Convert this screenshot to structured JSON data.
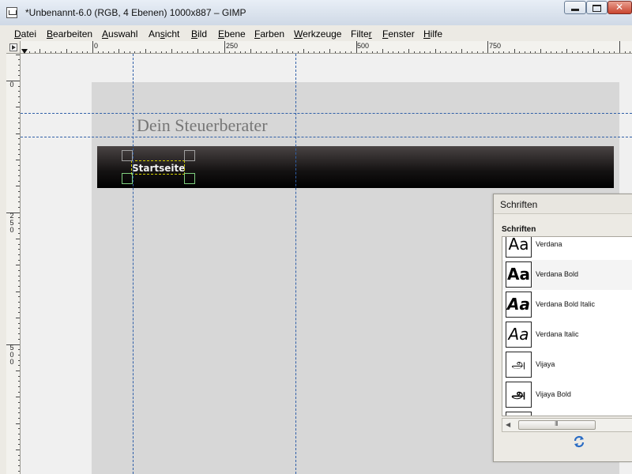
{
  "window": {
    "title": "*Unbenannt-6.0 (RGB, 4 Ebenen) 1000x887 – GIMP"
  },
  "menu": [
    {
      "pre": "",
      "u": "D",
      "post": "atei"
    },
    {
      "pre": "",
      "u": "B",
      "post": "earbeiten"
    },
    {
      "pre": "",
      "u": "A",
      "post": "uswahl"
    },
    {
      "pre": "An",
      "u": "s",
      "post": "icht"
    },
    {
      "pre": "",
      "u": "B",
      "post": "ild"
    },
    {
      "pre": "",
      "u": "E",
      "post": "bene"
    },
    {
      "pre": "",
      "u": "F",
      "post": "arben"
    },
    {
      "pre": "",
      "u": "W",
      "post": "erkzeuge"
    },
    {
      "pre": "Filte",
      "u": "r",
      "post": ""
    },
    {
      "pre": "",
      "u": "F",
      "post": "enster"
    },
    {
      "pre": "",
      "u": "H",
      "post": "ilfe"
    }
  ],
  "rulers": {
    "horizontal": [
      "0",
      "250",
      "500",
      "750"
    ],
    "vertical": [
      "0",
      "250",
      "500"
    ]
  },
  "canvas": {
    "site_title": "Dein Steuerberater",
    "nav_item": "Startseite",
    "guide_color": "#2f5fa8",
    "selection_color": "#d6d200"
  },
  "fonts_dialog": {
    "title": "Schriften",
    "tab_label": "Schriften",
    "fonts": [
      {
        "name": "Verdana",
        "preview": "Aa",
        "icon": "font-preview-regular"
      },
      {
        "name": "Verdana Bold",
        "preview": "Aa",
        "icon": "font-preview-bold"
      },
      {
        "name": "Verdana Bold Italic",
        "preview": "Aa",
        "icon": "font-preview-bold-italic"
      },
      {
        "name": "Verdana Italic",
        "preview": "Aa",
        "icon": "font-preview-italic"
      },
      {
        "name": "Vijaya",
        "preview": "அ",
        "icon": "font-preview-tamil"
      },
      {
        "name": "Vijaya Bold",
        "preview": "அ",
        "icon": "font-preview-tamil-bold"
      },
      {
        "name": "",
        "preview": "",
        "icon": "font-preview-partial"
      }
    ],
    "scroll_grip": "III"
  }
}
